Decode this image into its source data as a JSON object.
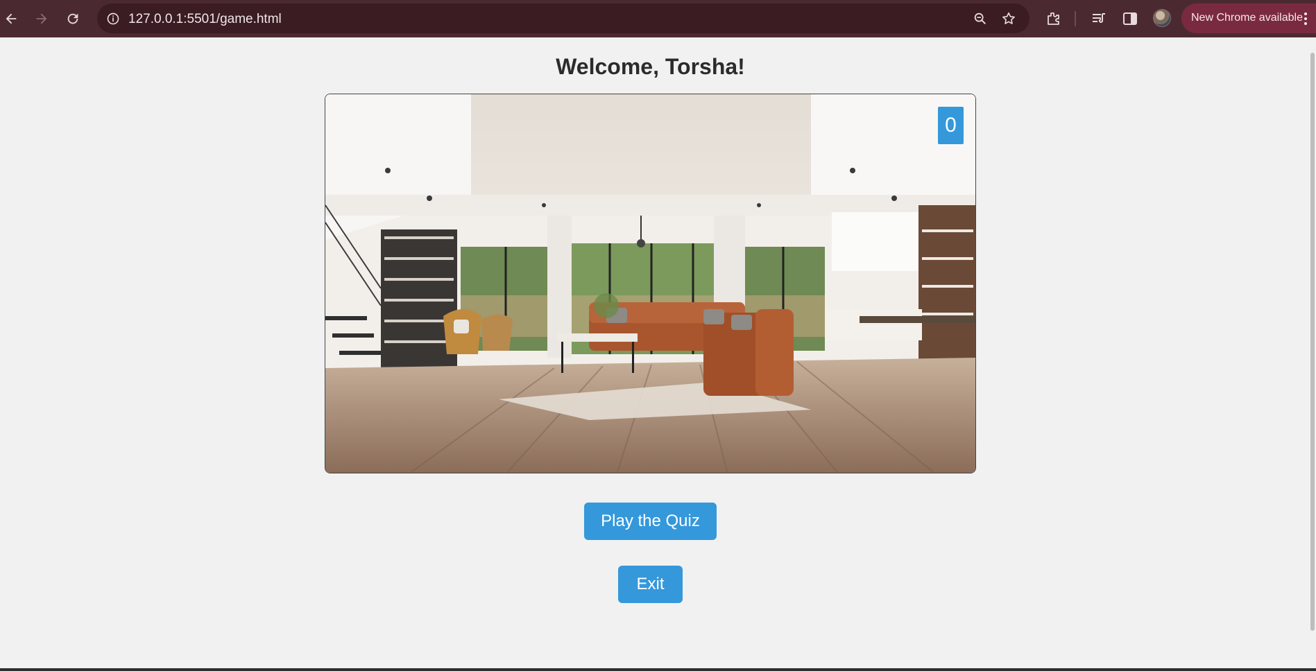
{
  "browser": {
    "url": "127.0.0.1:5501/game.html",
    "update_label": "New Chrome available",
    "icons": [
      "back-arrow-icon",
      "forward-arrow-icon",
      "reload-icon",
      "site-info-icon",
      "zoom-icon",
      "bookmark-star-icon",
      "extensions-icon",
      "reading-list-icon",
      "side-panel-icon",
      "profile-avatar",
      "kebab-menu-icon"
    ]
  },
  "page": {
    "title": "Welcome, Torsha!",
    "score": "0",
    "play_label": "Play the Quiz",
    "exit_label": "Exit"
  },
  "colors": {
    "chrome_bg": "#4a2a30",
    "omnibox_bg": "#3a1c22",
    "accent": "#3498db",
    "page_bg": "#f1f1f1"
  }
}
